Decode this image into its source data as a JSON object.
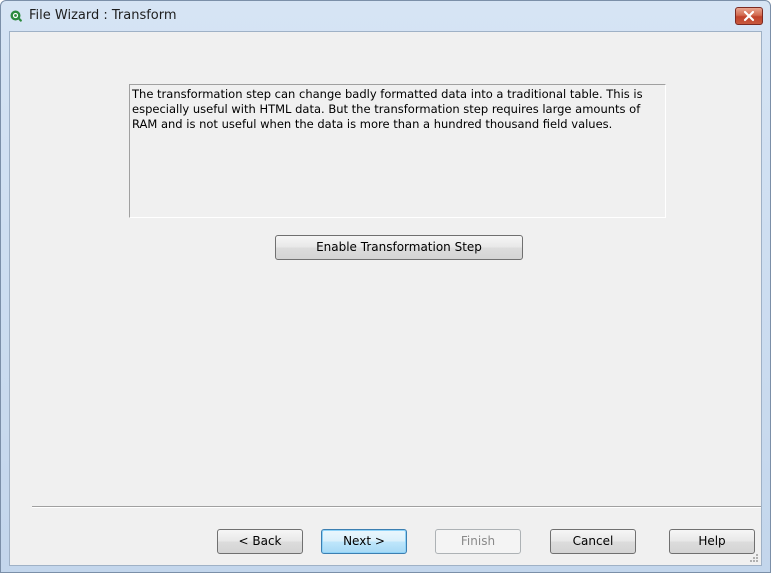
{
  "window": {
    "title": "File Wizard : Transform",
    "icon": "qlikview-logo-icon",
    "close_icon": "close-icon"
  },
  "description": "The transformation step can change badly formatted data into a traditional table. This is especially useful with HTML data. But the transformation step requires large amounts of RAM and is not useful when the data is more than a hundred thousand field values.",
  "buttons": {
    "enable_transformation": "Enable Transformation Step",
    "back": "< Back",
    "next": "Next >",
    "finish": "Finish",
    "cancel": "Cancel",
    "help": "Help"
  },
  "state": {
    "default_button": "next",
    "disabled_buttons": [
      "finish"
    ]
  },
  "colors": {
    "client_background": "#f0f0f0",
    "titlebar": "#c8daee",
    "close_button": "#c85a3e",
    "default_button_border": "#3c7fb1"
  }
}
